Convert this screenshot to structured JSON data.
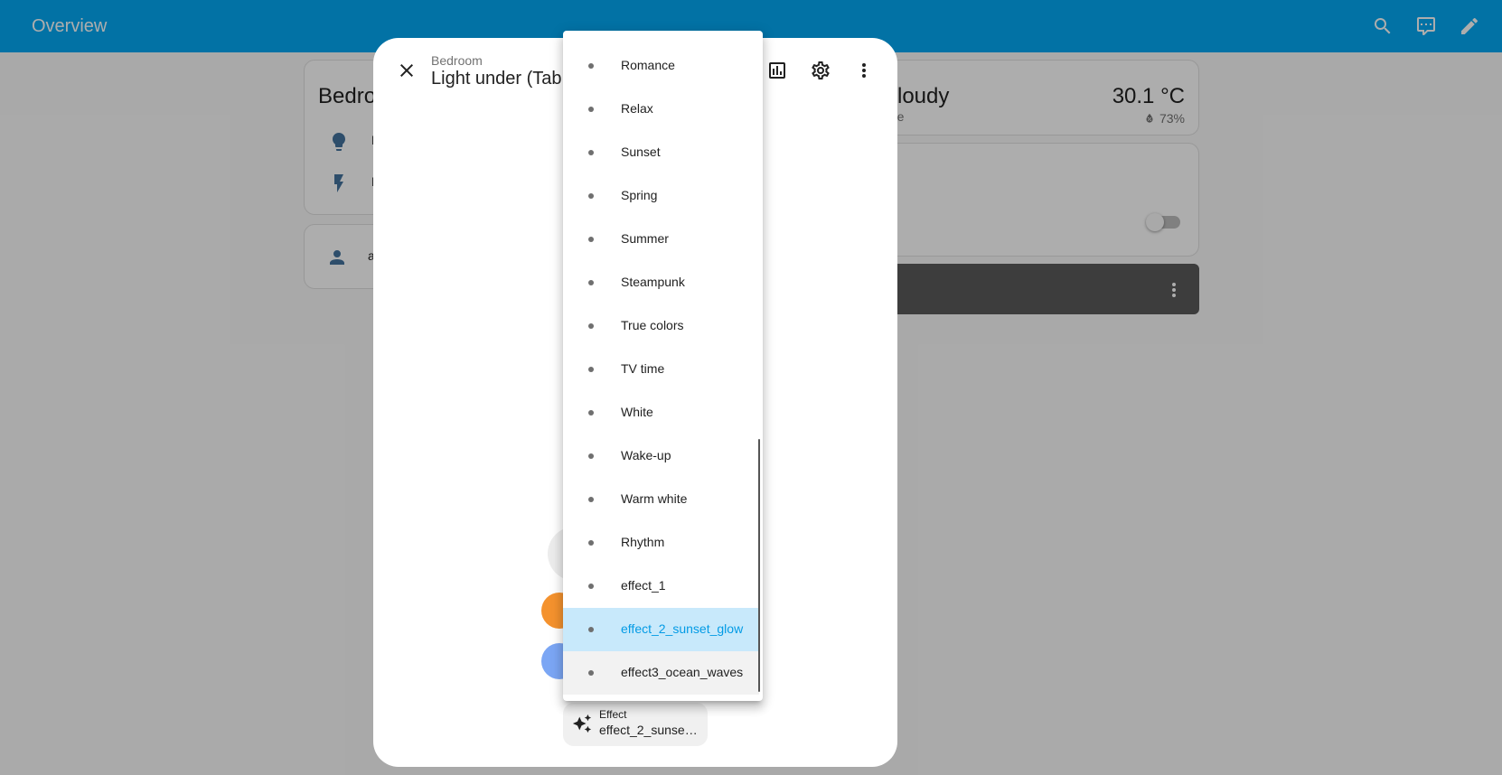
{
  "app": {
    "title": "Overview",
    "header_icons": [
      "search-icon",
      "assist-icon",
      "pencil-icon"
    ]
  },
  "cards": {
    "bedroom": {
      "title": "Bedroom",
      "rows": [
        {
          "icon": "lightbulb-icon",
          "text": "L"
        },
        {
          "icon": "flash-icon",
          "text": "L"
        }
      ]
    },
    "person": {
      "icon": "person-icon",
      "text": "a"
    },
    "weather": {
      "state": "cloudy",
      "name": "me",
      "temperature": "30.1 °C",
      "humidity": "73%"
    },
    "toggle": {
      "checked": false
    },
    "media": {
      "icon": "dots-vertical-icon"
    }
  },
  "dialog": {
    "area": "Bedroom",
    "title": "Light under (Tab",
    "header_icons": [
      "chart-icon",
      "cog-icon",
      "dots-vertical-icon"
    ],
    "effect": {
      "label": "Effect",
      "value": "effect_2_sunset_glow",
      "value_display": "effect_2_sunse…"
    },
    "colors": [
      "#f4922e",
      "#7ba6f4"
    ]
  },
  "effect_menu": {
    "items": [
      "Romance",
      "Relax",
      "Sunset",
      "Spring",
      "Summer",
      "Steampunk",
      "True colors",
      "TV time",
      "White",
      "Wake-up",
      "Warm white",
      "Rhythm",
      "effect_1",
      "effect_2_sunset_glow",
      "effect3_ocean_waves"
    ],
    "selected": "effect_2_sunset_glow",
    "hovered": "effect3_ocean_waves",
    "colors": {
      "selected_bg": "#c8e9fb",
      "selected_text": "#039be5"
    }
  },
  "theme": {
    "primary": "#03a9f4",
    "state_icon": "#44739e"
  }
}
